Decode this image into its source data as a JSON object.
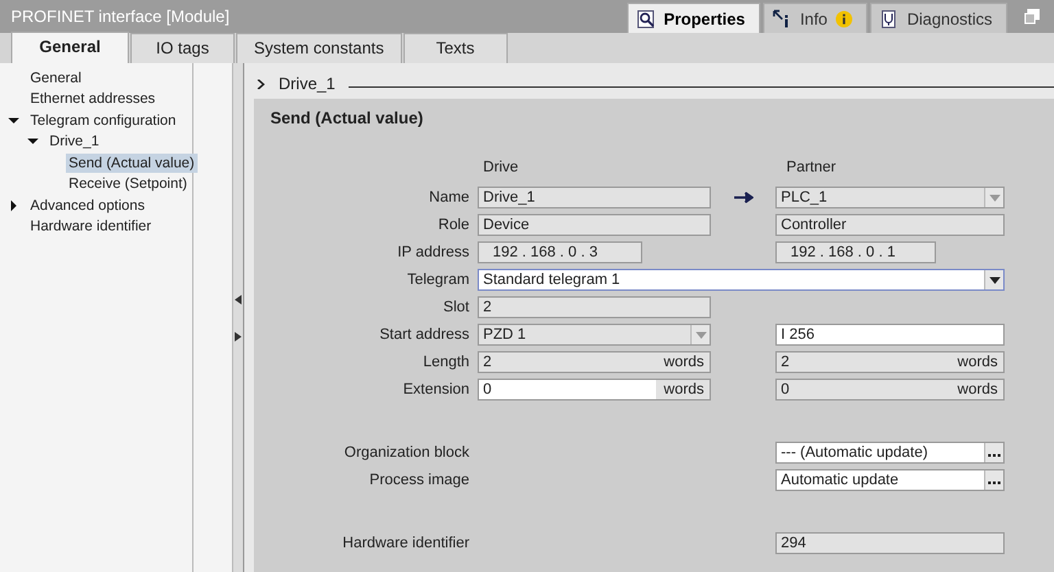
{
  "window": {
    "title": "PROFINET interface [Module]"
  },
  "panel_tabs": [
    {
      "label": "Properties",
      "kind": "properties",
      "selected": true
    },
    {
      "label": "Info",
      "kind": "info",
      "selected": false
    },
    {
      "label": "Diagnostics",
      "kind": "diagnostics",
      "selected": false
    }
  ],
  "tabs": [
    {
      "label": "General",
      "selected": true
    },
    {
      "label": "IO tags",
      "selected": false
    },
    {
      "label": "System constants",
      "selected": false
    },
    {
      "label": "Texts",
      "selected": false
    }
  ],
  "sidebar": {
    "items": [
      {
        "label": "General",
        "selected": false
      },
      {
        "label": "Ethernet addresses",
        "selected": false
      },
      {
        "label": "Telegram configuration",
        "selected": false,
        "expanded": true,
        "children": [
          {
            "label": "Drive_1",
            "selected": false,
            "expanded": true,
            "children": [
              {
                "label": "Send (Actual value)",
                "selected": true
              },
              {
                "label": "Receive (Setpoint)",
                "selected": false
              }
            ]
          }
        ]
      },
      {
        "label": "Advanced options",
        "selected": false,
        "expanded": false
      },
      {
        "label": "Hardware identifier",
        "selected": false
      }
    ]
  },
  "breadcrumb": {
    "label": "Drive_1"
  },
  "section": {
    "title": "Send (Actual value)",
    "column_headers": [
      "Drive",
      "Partner"
    ],
    "row_groups": [
      [
        {
          "label": "Name",
          "kind": "pair",
          "arrow": true,
          "drive": {
            "kind": "dropdown",
            "value": "Drive_1",
            "editable": false,
            "no_arrow": true
          },
          "partner": {
            "kind": "dropdown",
            "value": "PLC_1",
            "editable": false
          }
        },
        {
          "label": "Role",
          "kind": "pair",
          "drive": {
            "kind": "text",
            "value": "Device",
            "editable": false
          },
          "partner": {
            "kind": "text",
            "value": "Controller",
            "editable": false
          }
        },
        {
          "label": "IP address",
          "kind": "pair",
          "drive": {
            "kind": "ip",
            "value": "192 . 168 . 0 . 3",
            "editable": false
          },
          "partner": {
            "kind": "ip",
            "value": "192 . 168 . 0 . 1",
            "editable": false
          }
        },
        {
          "label": "Telegram",
          "kind": "wide",
          "drive": {
            "kind": "dropdown",
            "value": "Standard telegram 1",
            "editable": true
          }
        },
        {
          "label": "Slot",
          "kind": "pair",
          "drive": {
            "kind": "text",
            "value": "2",
            "editable": false
          }
        },
        {
          "label": "Start address",
          "kind": "pair",
          "drive": {
            "kind": "dropdown",
            "value": "PZD 1",
            "editable": false
          },
          "partner": {
            "kind": "text",
            "value": "I 256",
            "editable": true
          }
        },
        {
          "label": "Length",
          "kind": "pair",
          "drive": {
            "kind": "text",
            "value": "2",
            "unit": "words",
            "editable": false
          },
          "partner": {
            "kind": "text",
            "value": "2",
            "unit": "words",
            "editable": false
          }
        },
        {
          "label": "Extension",
          "kind": "pair",
          "drive": {
            "kind": "text",
            "value": "0",
            "unit": "words",
            "editable": true
          },
          "partner": {
            "kind": "text",
            "value": "0",
            "unit": "words",
            "editable": false
          }
        }
      ],
      [
        {
          "label": "Organization block",
          "kind": "pair",
          "partner": {
            "kind": "browse",
            "value": "--- (Automatic update)",
            "editable": true
          }
        },
        {
          "label": "Process image",
          "kind": "pair",
          "partner": {
            "kind": "browse",
            "value": "Automatic update",
            "editable": true
          }
        }
      ],
      [
        {
          "label": "Hardware identifier",
          "kind": "pair",
          "partner": {
            "kind": "text",
            "value": "294",
            "editable": false
          }
        }
      ]
    ]
  }
}
